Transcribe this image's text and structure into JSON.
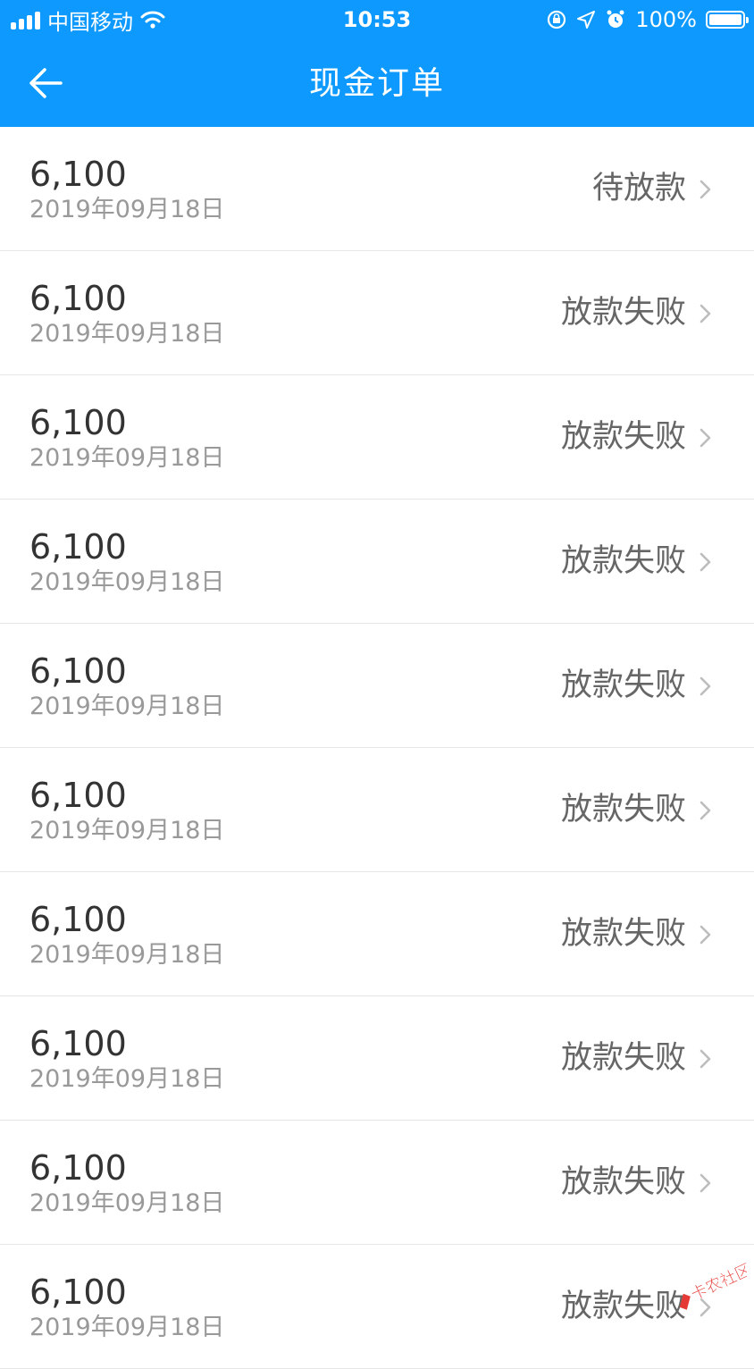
{
  "status_bar": {
    "carrier": "中国移动",
    "time": "10:53",
    "battery": "100%"
  },
  "nav": {
    "title": "现金订单"
  },
  "orders": [
    {
      "amount": "6,100",
      "date": "2019年09月18日",
      "status": "待放款"
    },
    {
      "amount": "6,100",
      "date": "2019年09月18日",
      "status": "放款失败"
    },
    {
      "amount": "6,100",
      "date": "2019年09月18日",
      "status": "放款失败"
    },
    {
      "amount": "6,100",
      "date": "2019年09月18日",
      "status": "放款失败"
    },
    {
      "amount": "6,100",
      "date": "2019年09月18日",
      "status": "放款失败"
    },
    {
      "amount": "6,100",
      "date": "2019年09月18日",
      "status": "放款失败"
    },
    {
      "amount": "6,100",
      "date": "2019年09月18日",
      "status": "放款失败"
    },
    {
      "amount": "6,100",
      "date": "2019年09月18日",
      "status": "放款失败"
    },
    {
      "amount": "6,100",
      "date": "2019年09月18日",
      "status": "放款失败"
    },
    {
      "amount": "6,100",
      "date": "2019年09月18日",
      "status": "放款失败"
    }
  ],
  "icons": {
    "back": "back-arrow-icon",
    "chevron": "chevron-right-icon",
    "signal": "signal-icon",
    "wifi": "wifi-icon",
    "lock_rotation": "rotation-lock-icon",
    "location": "location-icon",
    "alarm": "alarm-icon",
    "battery": "battery-icon"
  },
  "colors": {
    "header": "#0d99fd",
    "amount": "#333333",
    "date": "#999999",
    "status": "#666666"
  },
  "watermark": {
    "text": "卡农社区"
  }
}
